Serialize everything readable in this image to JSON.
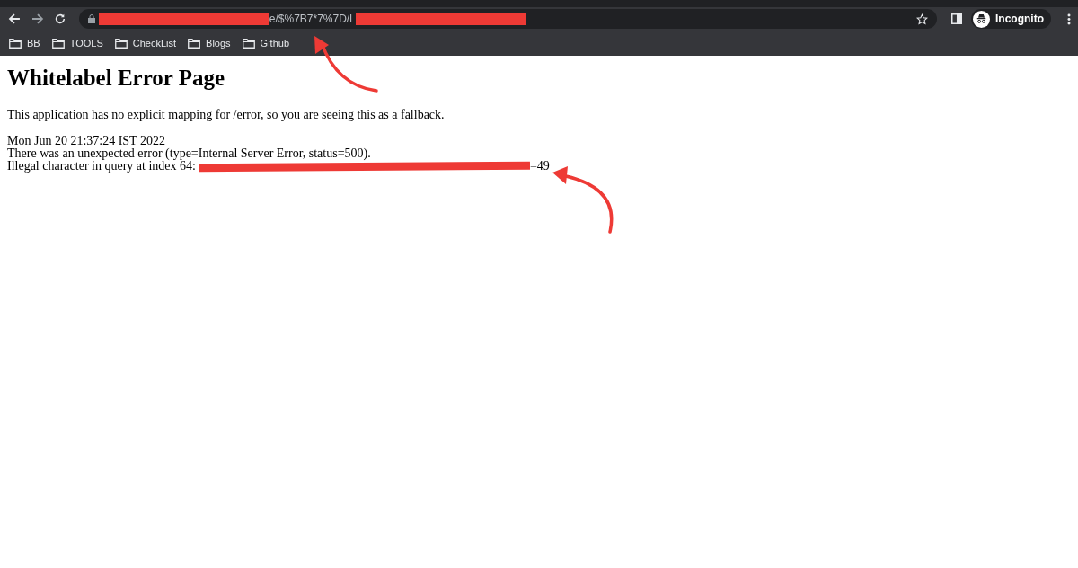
{
  "toolbar": {
    "url_fragment": "e/$%7B7*7%7D/l",
    "profile": "Incognito"
  },
  "bookmarks": [
    {
      "label": "BB"
    },
    {
      "label": "TOOLS"
    },
    {
      "label": "CheckList"
    },
    {
      "label": "Blogs"
    },
    {
      "label": "Github"
    }
  ],
  "page": {
    "heading": "Whitelabel Error Page",
    "intro": "This application has no explicit mapping for /error, so you are seeing this as a fallback.",
    "timestamp": "Mon Jun 20 21:37:24 IST 2022",
    "error": "There was an unexpected error (type=Internal Server Error, status=500).",
    "detail_prefix": "Illegal character in query at index 64:",
    "detail_suffix": "=49"
  }
}
